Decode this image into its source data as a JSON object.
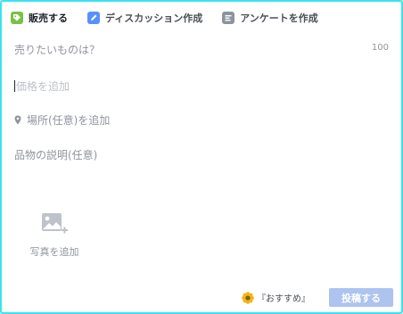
{
  "tabs": [
    {
      "label": "販売する",
      "icon": "tag-icon",
      "color": "#7ac143"
    },
    {
      "label": "ディスカッション作成",
      "icon": "pencil-icon",
      "color": "#5890ff"
    },
    {
      "label": "アンケートを作成",
      "icon": "poll-icon",
      "color": "#8d949e"
    }
  ],
  "form": {
    "title_placeholder": "売りたいものは？",
    "title_counter": "100",
    "price_placeholder": "価格を追加",
    "location_placeholder": "場所(任意)を追加",
    "description_placeholder": "品物の説明(任意)"
  },
  "photo": {
    "label": "写真を追加",
    "icon": "add-photo-icon"
  },
  "footer": {
    "recommend_label": "『おすすめ』",
    "recommend_icon": "sunflower-icon",
    "post_label": "投稿する",
    "post_color": "#adc3f0"
  },
  "colors": {
    "frame_border": "#39e4ee"
  }
}
